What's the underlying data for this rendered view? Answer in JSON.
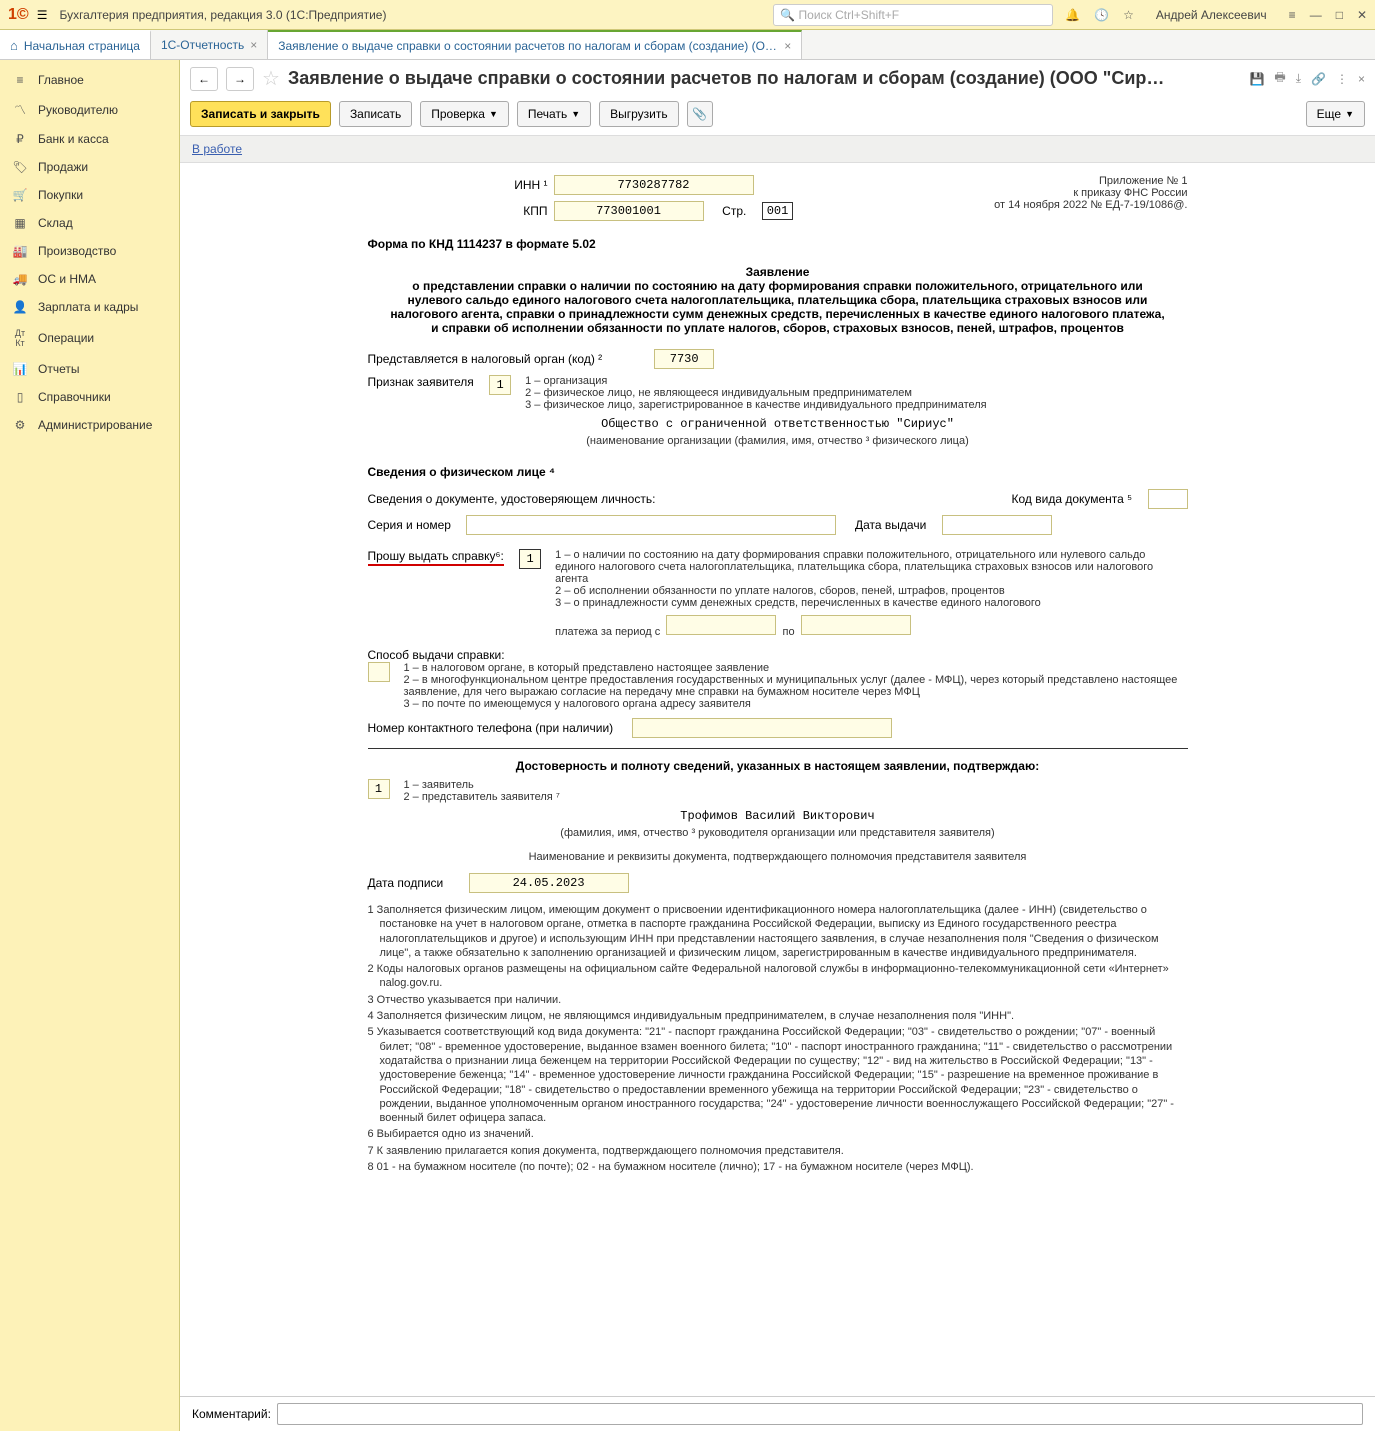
{
  "titlebar": {
    "title": "Бухгалтерия предприятия, редакция 3.0  (1С:Предприятие)",
    "search_placeholder": "Поиск Ctrl+Shift+F",
    "user": "Андрей Алексеевич"
  },
  "tabs": {
    "start": "Начальная страница",
    "t1": "1С-Отчетность",
    "t2": "Заявление о выдаче справки о состоянии расчетов по налогам и сборам (создание) (ООО \"Сириус\") *"
  },
  "sidebar": {
    "items": [
      {
        "label": "Главное"
      },
      {
        "label": "Руководителю"
      },
      {
        "label": "Банк и касса"
      },
      {
        "label": "Продажи"
      },
      {
        "label": "Покупки"
      },
      {
        "label": "Склад"
      },
      {
        "label": "Производство"
      },
      {
        "label": "ОС и НМА"
      },
      {
        "label": "Зарплата и кадры"
      },
      {
        "label": "Операции"
      },
      {
        "label": "Отчеты"
      },
      {
        "label": "Справочники"
      },
      {
        "label": "Администрирование"
      }
    ]
  },
  "doc": {
    "title": "Заявление о выдаче справки о состоянии расчетов по налогам и сборам (создание) (ООО \"Сир…"
  },
  "toolbar": {
    "save_close": "Записать и закрыть",
    "save": "Записать",
    "check": "Проверка",
    "print": "Печать",
    "export": "Выгрузить",
    "more": "Еще"
  },
  "status": {
    "label": "В работе"
  },
  "form": {
    "inn_label": "ИНН ¹",
    "inn": "7730287782",
    "kpp_label": "КПП",
    "kpp": "773001001",
    "page_label": "Стр.",
    "page": "001",
    "appendix_l1": "Приложение № 1",
    "appendix_l2": "к приказу ФНС России",
    "appendix_l3": "от 14 ноября 2022 № ЕД-7-19/1086@.",
    "knd": "Форма по КНД 1114237 в формате 5.02",
    "zayav": "Заявление",
    "zayav_body": "о представлении справки о наличии по состоянию на дату формирования справки положительного, отрицательного или нулевого сальдо единого налогового счета налогоплательщика, плательщика сбора, плательщика страховых взносов или налогового агента, справки о принадлежности сумм денежных средств, перечисленных в качестве единого налогового платежа, и справки об исполнении обязанности по уплате налогов, сборов, страховых взносов, пеней, штрафов, процентов",
    "presented_label": "Представляется в налоговый орган (код) ²",
    "presented": "7730",
    "sign_label": "Признак заявителя",
    "sign_val": "1",
    "sign_1": "1 – организация",
    "sign_2": "2 – физическое лицо, не являющееся индивидуальным предпринимателем",
    "sign_3": "3 – физическое лицо, зарегистрированное в качестве индивидуального предпринимателя",
    "org_name": "Общество с ограниченной ответственностью \"Сириус\"",
    "org_sub": "(наименование организации (фамилия, имя, отчество ³ физического лица)",
    "fiz_title": "Сведения о физическом лице ⁴",
    "fiz_doc_label": "Сведения о документе, удостоверяющем личность:",
    "doc_code_label": "Код вида документа ⁵",
    "series_label": "Серия и номер",
    "issue_date_label": "Дата выдачи",
    "request_label": "Прошу выдать справку⁶:",
    "request_val": "1",
    "req_1": "1 – о наличии по состоянию на дату формирования справки положительного, отрицательного или нулевого сальдо единого налогового счета налогоплательщика, плательщика сбора, плательщика страховых взносов или налогового агента",
    "req_2": "2 – об исполнении обязанности по уплате налогов, сборов, пеней, штрафов, процентов",
    "req_3": "3 – о принадлежности сумм денежных средств, перечисленных в качестве единого налогового",
    "period_from": "платежа за период с",
    "period_to": "по",
    "method_label": "Способ выдачи справки:",
    "method_1": "1 – в налоговом органе, в который представлено настоящее заявление",
    "method_2": "2 – в многофункциональном центре предоставления государственных и муниципальных услуг (далее - МФЦ), через который представлено настоящее заявление, для чего выражаю согласие на передачу мне справки на бумажном носителе через МФЦ",
    "method_3": "3 – по почте по имеющемуся у налогового органа адресу заявителя",
    "phone_label": "Номер контактного телефона (при наличии)",
    "confirm_title": "Достоверность и полноту сведений, указанных в настоящем заявлении, подтверждаю:",
    "confirm_val": "1",
    "confirm_1": "1 – заявитель",
    "confirm_2": "2 – представитель заявителя ⁷",
    "signer": "Трофимов Василий Викторович",
    "signer_sub": "(фамилия, имя, отчество ³ руководителя организации или представителя заявителя)",
    "authority_sub": "Наименование и реквизиты документа, подтверждающего полномочия представителя заявителя",
    "sign_date_label": "Дата подписи",
    "sign_date": "24.05.2023",
    "fn1": "1 Заполняется физическим лицом, имеющим документ о присвоении идентификационного номера налогоплательщика (далее - ИНН) (свидетельство о постановке на учет в налоговом органе, отметка в паспорте гражданина Российской Федерации, выписку из Единого государственного реестра налогоплательщиков и другое) и использующим ИНН при представлении настоящего заявления, в случае незаполнения поля \"Сведения о физическом лице\", а также обязательно к заполнению организацией и физическим лицом, зарегистрированным в качестве индивидуального предпринимателя.",
    "fn2": "2 Коды налоговых органов размещены на официальном сайте Федеральной налоговой службы в информационно-телекоммуникационной сети «Интернет» nalog.gov.ru.",
    "fn3": "3 Отчество указывается при наличии.",
    "fn4": "4 Заполняется физическим лицом, не являющимся индивидуальным предпринимателем, в случае незаполнения поля \"ИНН\".",
    "fn5": "5 Указывается соответствующий код вида документа: \"21\" - паспорт гражданина Российской Федерации; \"03\" - свидетельство о рождении; \"07\" - военный билет; \"08\" - временное удостоверение, выданное взамен военного билета; \"10\" - паспорт иностранного гражданина; \"11\" - свидетельство о рассмотрении ходатайства о признании лица беженцем на территории Российской Федерации по существу; \"12\" - вид на жительство в Российской Федерации; \"13\" - удостоверение беженца; \"14\" - временное удостоверение личности гражданина Российской Федерации; \"15\" - разрешение на временное проживание в Российской Федерации; \"18\" - свидетельство о предоставлении временного убежища на территории Российской Федерации; \"23\" - свидетельство о рождении, выданное уполномоченным органом иностранного государства; \"24\" - удостоверение личности военнослужащего Российской Федерации; \"27\" - военный билет офицера запаса.",
    "fn6": "6 Выбирается одно из значений.",
    "fn7": "7 К заявлению прилагается копия документа, подтверждающего полномочия представителя.",
    "fn8": "8 01 - на бумажном носителе (по почте); 02 - на бумажном носителе (лично); 17 - на бумажном носителе (через МФЦ)."
  },
  "comment": {
    "label": "Комментарий:"
  }
}
